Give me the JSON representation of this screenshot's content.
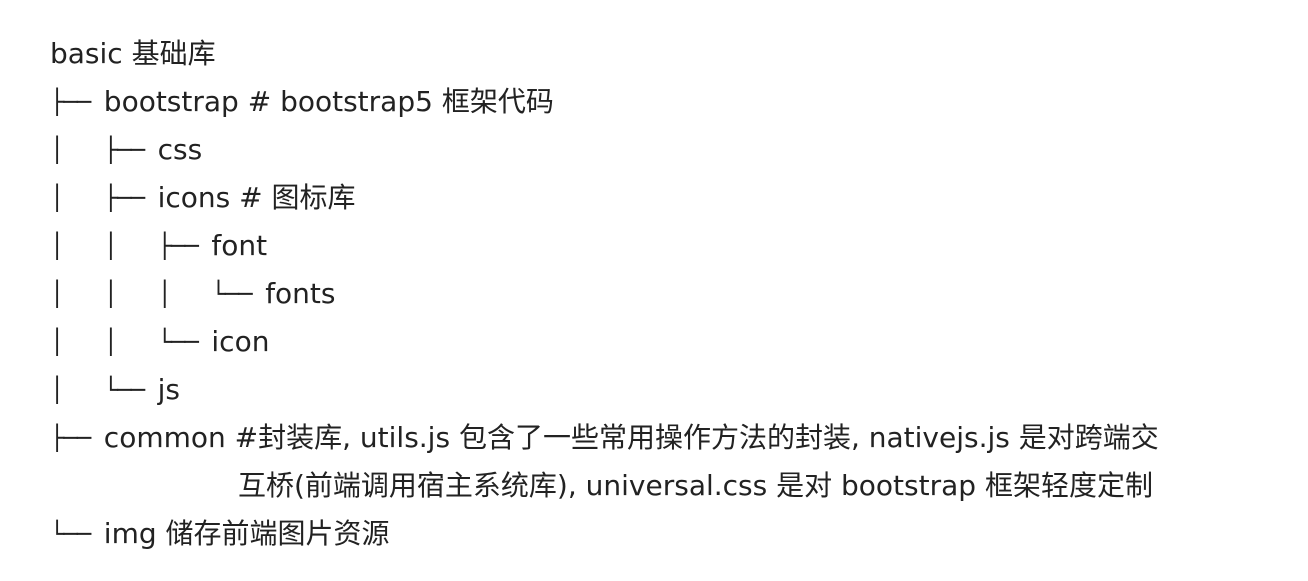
{
  "tree": {
    "root": "basic 基础库",
    "rows": [
      {
        "prefix": "├── ",
        "label": "bootstrap # bootstrap5 框架代码"
      },
      {
        "prefix": "│   ├── ",
        "label": "css"
      },
      {
        "prefix": "│   ├── ",
        "label": "icons # 图标库"
      },
      {
        "prefix": "│   │   ├── ",
        "label": "font"
      },
      {
        "prefix": "│   │   │   └── ",
        "label": "fonts"
      },
      {
        "prefix": "│   │   └── ",
        "label": "icon"
      },
      {
        "prefix": "│   └── ",
        "label": "js"
      },
      {
        "prefix": "├── ",
        "label": "common #封装库, utils.js 包含了一些常用操作方法的封装, nativejs.js 是对跨端交"
      },
      {
        "continuation": "互桥(前端调用宿主系统库), universal.css 是对 bootstrap 框架轻度定制"
      },
      {
        "prefix": "└── ",
        "label": "img 储存前端图片资源"
      }
    ]
  }
}
